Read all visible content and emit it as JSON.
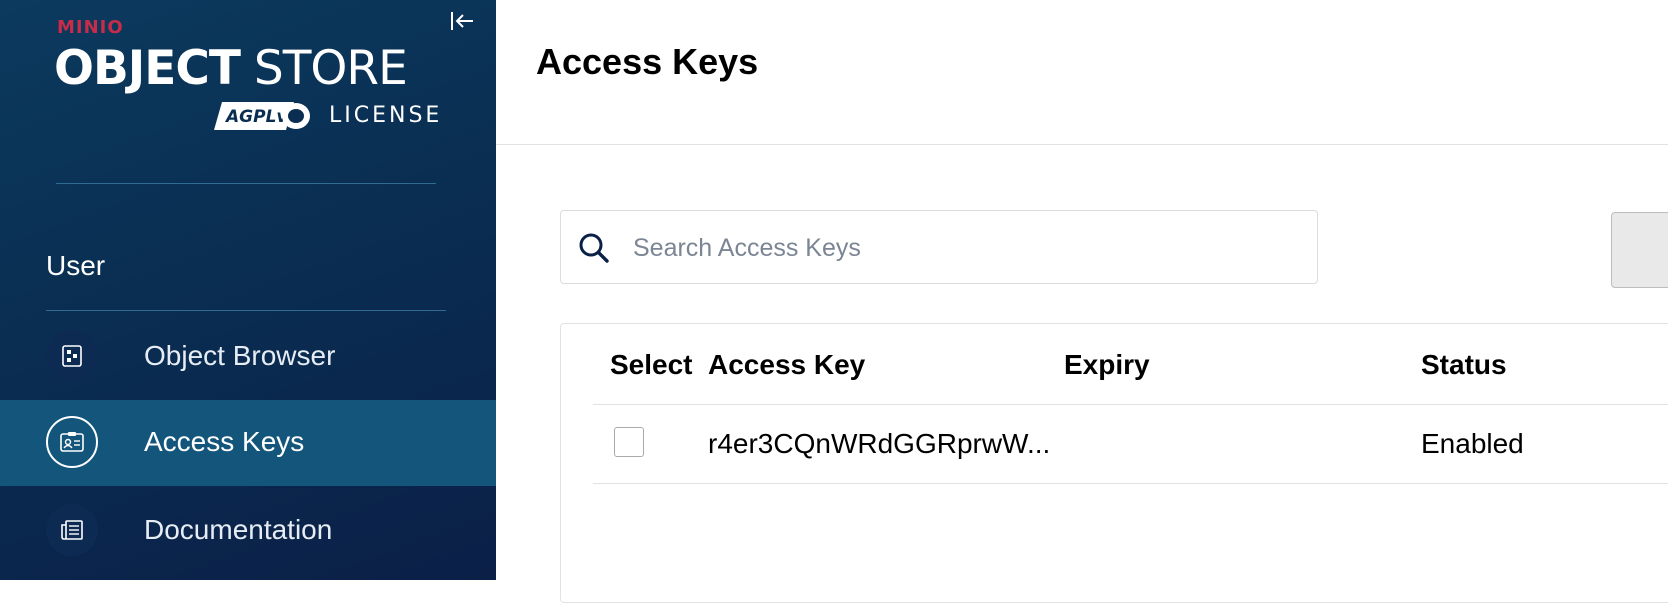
{
  "app": {
    "brand": "MINIO",
    "product_bold": "OBJECT",
    "product_light": "STORE",
    "license_badge": "AGPLv3",
    "license": "LICENSE"
  },
  "sidebar": {
    "section_label": "User",
    "items": [
      {
        "label": "Object Browser",
        "icon": "object-browser-icon",
        "active": false
      },
      {
        "label": "Access Keys",
        "icon": "access-keys-icon",
        "active": true
      },
      {
        "label": "Documentation",
        "icon": "documentation-icon",
        "active": false
      }
    ]
  },
  "page": {
    "title": "Access Keys"
  },
  "search": {
    "placeholder": "Search Access Keys",
    "value": ""
  },
  "table": {
    "columns": [
      "Select",
      "Access Key",
      "Expiry",
      "Status"
    ],
    "rows": [
      {
        "selected": false,
        "access_key": "r4er3CQnWRdGGRprwW...",
        "expiry": "",
        "status": "Enabled"
      }
    ]
  },
  "colors": {
    "sidebar_bg": "#0a2e52",
    "active_item_bg": "#14557c",
    "brand_red": "#c72c48"
  }
}
